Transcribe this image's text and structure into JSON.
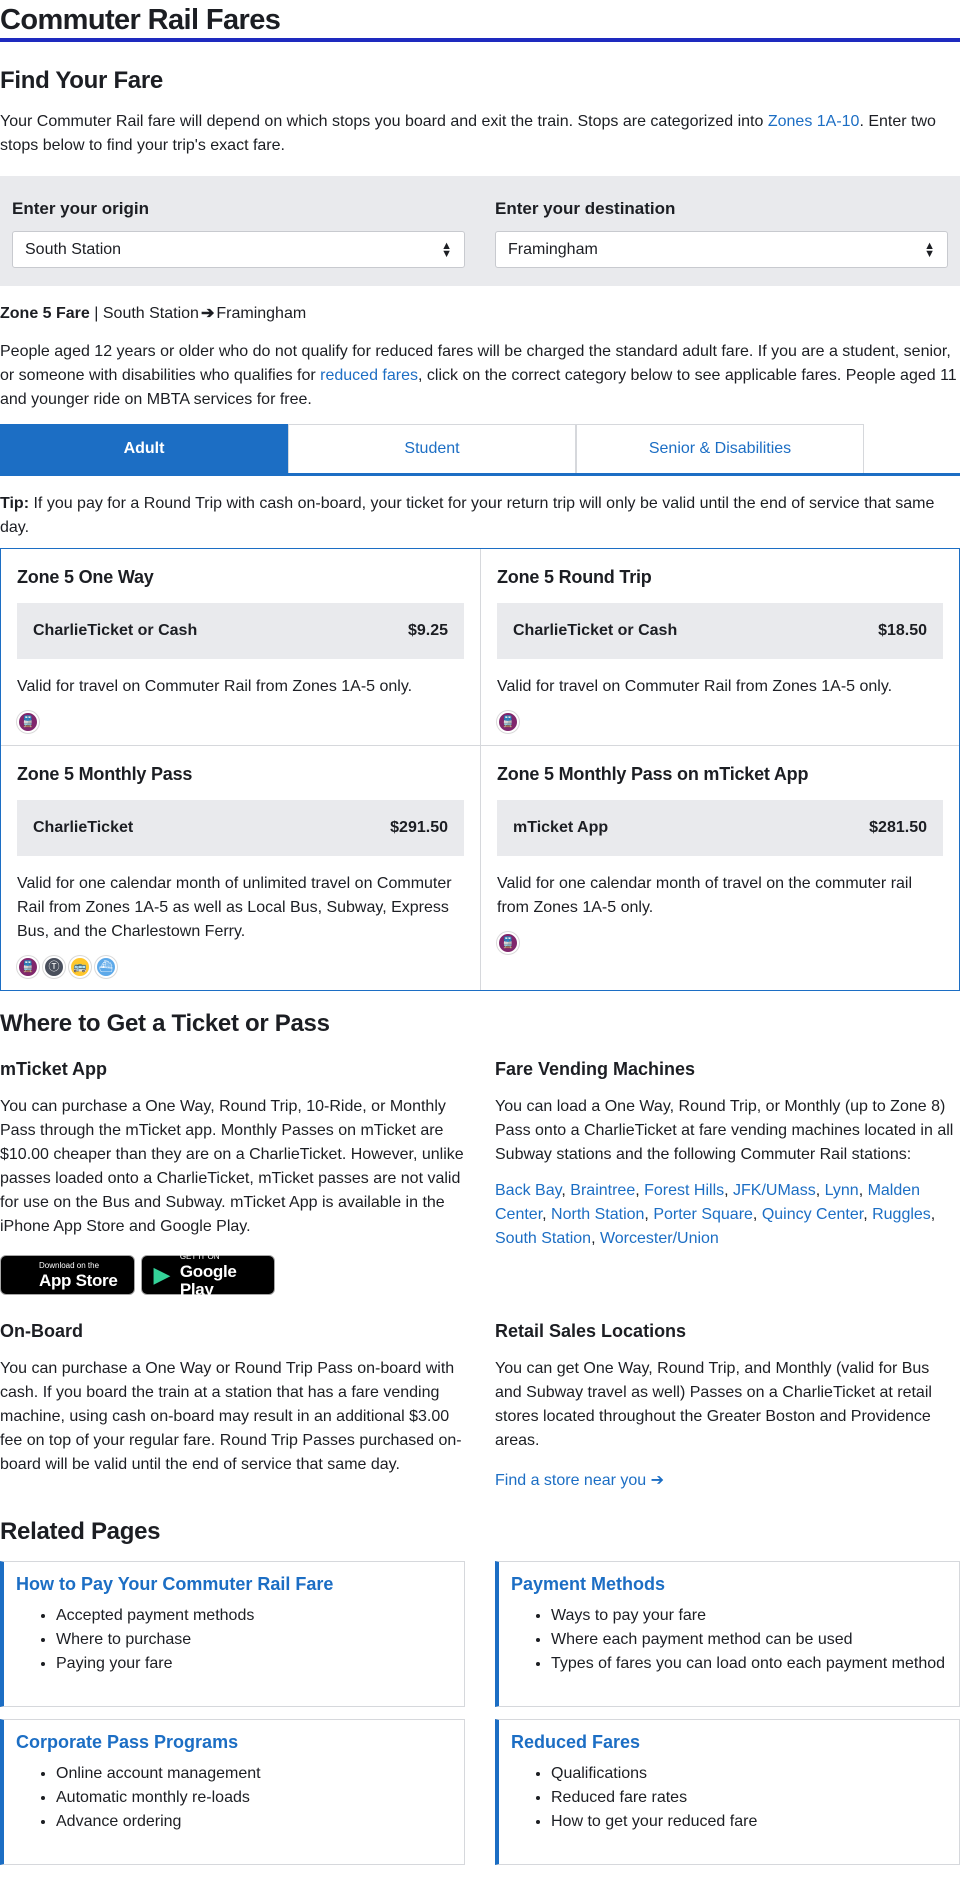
{
  "page_title": "Commuter Rail Fares",
  "find_fare": {
    "heading": "Find Your Fare",
    "intro_before": "Your Commuter Rail fare will depend on which stops you board and exit the train. Stops are categorized into ",
    "intro_link": "Zones 1A-10",
    "intro_after": ". Enter two stops below to find your trip's exact fare.",
    "origin_label": "Enter your origin",
    "origin_value": "South Station",
    "destination_label": "Enter your destination",
    "destination_value": "Framingham",
    "zone_fare": "Zone 5 Fare",
    "separator": "|",
    "from_station": "South Station",
    "to_station": "Framingham",
    "reduced_before": "People aged 12 years or older who do not qualify for reduced fares will be charged the standard adult fare. If you are a student, senior, or someone with disabilities who qualifies for ",
    "reduced_link": "reduced fares",
    "reduced_after": ", click on the correct category below to see applicable fares. People aged 11 and younger ride on MBTA services for free."
  },
  "tabs": [
    "Adult",
    "Student",
    "Senior & Disabilities"
  ],
  "tip": {
    "label": "Tip:",
    "text": " If you pay for a Round Trip with cash on-board, your ticket for your return trip will only be valid until the end of service that same day."
  },
  "fares": [
    {
      "title": "Zone 5 One Way",
      "media": "CharlieTicket or Cash",
      "price": "$9.25",
      "desc": "Valid for travel on Commuter Rail from Zones 1A-5 only.",
      "icons": [
        "commuter-rail-icon"
      ]
    },
    {
      "title": "Zone 5 Round Trip",
      "media": "CharlieTicket or Cash",
      "price": "$18.50",
      "desc": "Valid for travel on Commuter Rail from Zones 1A-5 only.",
      "icons": [
        "commuter-rail-icon"
      ]
    },
    {
      "title": "Zone 5 Monthly Pass",
      "media": "CharlieTicket",
      "price": "$291.50",
      "desc": "Valid for one calendar month of unlimited travel on Commuter Rail from Zones 1A-5 as well as Local Bus, Subway, Express Bus, and the Charlestown Ferry.",
      "icons": [
        "commuter-rail-icon",
        "subway-icon",
        "bus-icon",
        "ferry-icon"
      ]
    },
    {
      "title": "Zone 5 Monthly Pass on mTicket App",
      "media": "mTicket App",
      "price": "$281.50",
      "desc": "Valid for one calendar month of travel on the commuter rail from Zones 1A-5 only.",
      "icons": [
        "commuter-rail-icon"
      ]
    }
  ],
  "colors": {
    "accent": "#1c6ec4",
    "title_rule": "#1e2abf",
    "commuter_rail": "#80276c",
    "subway": "#494f5c",
    "bus": "#ffc72c",
    "ferry": "#008eaa"
  },
  "where": {
    "heading": "Where to Get a Ticket or Pass",
    "mticket_heading": "mTicket App",
    "mticket_text": "You can purchase a One Way, Round Trip, 10-Ride, or Monthly Pass through the mTicket app. Monthly Passes on mTicket are $10.00 cheaper than they are on a CharlieTicket. However, unlike passes loaded onto a CharlieTicket, mTicket passes are not valid for use on the Bus and Subway. mTicket App is available in the iPhone App Store and Google Play.",
    "appstore_small": "Download on the",
    "appstore_big": "App Store",
    "googleplay_small": "GET IT ON",
    "googleplay_big": "Google Play",
    "vending_heading": "Fare Vending Machines",
    "vending_text": "You can load a One Way, Round Trip, or Monthly (up to Zone 8) Pass onto a CharlieTicket at fare vending machines located in all Subway stations and the following Commuter Rail stations:",
    "stations": [
      "Back Bay",
      "Braintree",
      "Forest Hills",
      "JFK/UMass",
      "Lynn",
      "Malden Center",
      "North Station",
      "Porter Square",
      "Quincy Center",
      "Ruggles",
      "South Station",
      "Worcester/Union"
    ],
    "onboard_heading": "On-Board",
    "onboard_text": "You can purchase a One Way or Round Trip Pass on-board with cash. If you board the train at a station that has a fare vending machine, using cash on-board may result in an additional $3.00 fee on top of your regular fare. Round Trip Passes purchased on-board will be valid until the end of service that same day.",
    "retail_heading": "Retail Sales Locations",
    "retail_text": "You can get One Way, Round Trip, and Monthly (valid for Bus and Subway travel as well) Passes on a CharlieTicket at retail stores located throughout the Greater Boston and Providence areas.",
    "retail_link": "Find a store near you"
  },
  "related": {
    "heading": "Related Pages",
    "cards": [
      {
        "title": "How to Pay Your Commuter Rail Fare",
        "items": [
          "Accepted payment methods",
          "Where to purchase",
          "Paying your fare"
        ]
      },
      {
        "title": "Payment Methods",
        "items": [
          "Ways to pay your fare",
          "Where each payment method can be used",
          "Types of fares you can load onto each payment method"
        ]
      },
      {
        "title": "Corporate Pass Programs",
        "items": [
          "Online account management",
          "Automatic monthly re-loads",
          "Advance ordering"
        ]
      },
      {
        "title": "Reduced Fares",
        "items": [
          "Qualifications",
          "Reduced fare rates",
          "How to get your reduced fare"
        ]
      }
    ]
  }
}
